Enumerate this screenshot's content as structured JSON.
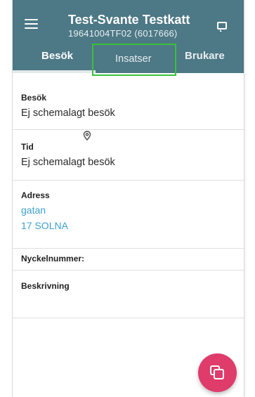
{
  "header": {
    "title": "Test-Svante Testkatt",
    "subtitle": "19641004TF02 (6017666)",
    "background_color": "#4d7886"
  },
  "tabs": [
    {
      "label": "Besök",
      "active": true
    },
    {
      "label": "Insatser",
      "active": false
    },
    {
      "label": "Brukare",
      "active": false
    }
  ],
  "details": {
    "visit_label": "Besök",
    "visit_value": "Ej schemalagt besök",
    "time_label": "Tid",
    "time_value": "Ej schemalagt besök",
    "address_label": "Adress",
    "address_street": "gatan",
    "address_city": "17 SOLNA",
    "key_number_label": "Nyckelnummer:",
    "description_label": "Beskrivning"
  },
  "icons": {
    "menu": "menu-icon",
    "chat": "chat-icon",
    "location": "location-pin-icon",
    "fab": "copy-icon"
  },
  "colors": {
    "accent": "#df3b6b",
    "link": "#3ca0cf",
    "highlight": "#39c13a"
  }
}
